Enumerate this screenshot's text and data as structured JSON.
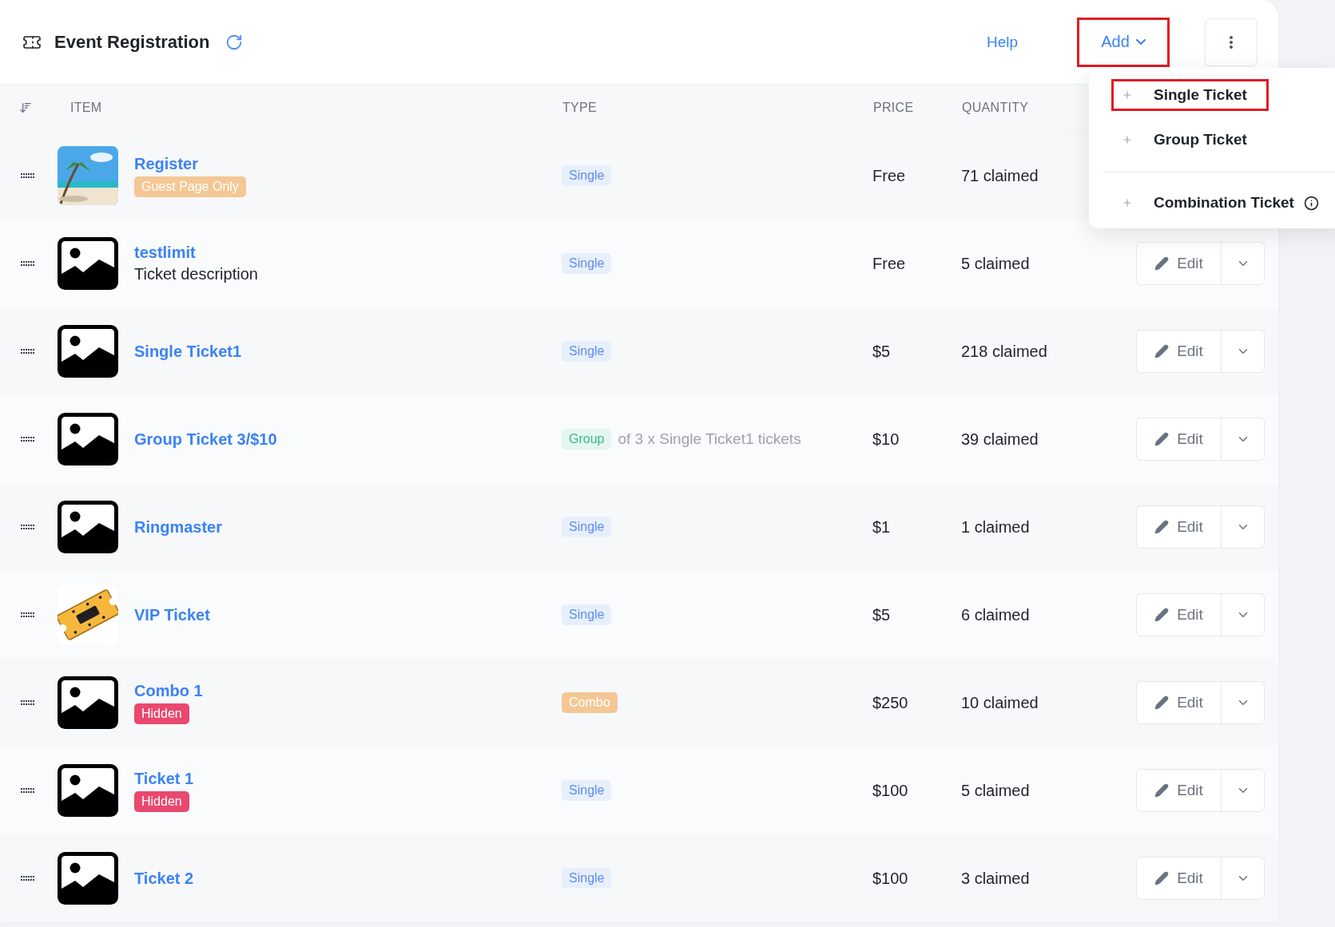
{
  "header": {
    "title": "Event Registration",
    "help": "Help",
    "add_button": {
      "label": "Add",
      "highlighted": true
    }
  },
  "add_menu": {
    "groups": [
      {
        "items": [
          {
            "label": "Single Ticket",
            "highlighted": true,
            "info": false
          },
          {
            "label": "Group Ticket",
            "highlighted": false,
            "info": false
          }
        ]
      },
      {
        "items": [
          {
            "label": "Combination Ticket",
            "highlighted": false,
            "info": true
          }
        ]
      }
    ]
  },
  "table": {
    "columns": [
      "ITEM",
      "TYPE",
      "PRICE",
      "QUANTITY"
    ],
    "rows": [
      {
        "name": "Register",
        "tag": {
          "kind": "guest",
          "label": "Guest Page Only"
        },
        "type": {
          "kind": "single",
          "label": "Single"
        },
        "price": "Free",
        "quantity": "71 claimed"
      },
      {
        "thumbnail": {
          "kind": "placeholder"
        },
        "name": "testlimit",
        "description": "Ticket description",
        "type": {
          "kind": "single",
          "label": "Single"
        },
        "price": "Free",
        "quantity": "5 claimed",
        "edit": "Edit"
      },
      {
        "thumbnail": {
          "kind": "placeholder"
        },
        "name": "Single Ticket1",
        "type": {
          "kind": "single",
          "label": "Single"
        },
        "price": "$5",
        "quantity": "218 claimed",
        "edit": "Edit"
      },
      {
        "thumbnail": {
          "kind": "placeholder"
        },
        "name": "Group Ticket 3/$10",
        "type": {
          "kind": "group",
          "label": "Group",
          "note": "of 3 x Single Ticket1 tickets"
        },
        "price": "$10",
        "quantity": "39 claimed",
        "edit": "Edit"
      },
      {
        "thumbnail": {
          "kind": "placeholder"
        },
        "name": "Ringmaster",
        "type": {
          "kind": "single",
          "label": "Single"
        },
        "price": "$1",
        "quantity": "1 claimed",
        "edit": "Edit"
      },
      {
        "name": "VIP Ticket",
        "type": {
          "kind": "single",
          "label": "Single"
        },
        "price": "$5",
        "quantity": "6 claimed",
        "edit": "Edit"
      },
      {
        "thumbnail": {
          "kind": "placeholder"
        },
        "name": "Combo 1",
        "tag": {
          "kind": "hidden",
          "label": "Hidden"
        },
        "type": {
          "kind": "combo",
          "label": "Combo"
        },
        "price": "$250",
        "quantity": "10 claimed",
        "edit": "Edit"
      },
      {
        "thumbnail": {
          "kind": "placeholder"
        },
        "name": "Ticket 1",
        "tag": {
          "kind": "hidden",
          "label": "Hidden"
        },
        "type": {
          "kind": "single",
          "label": "Single"
        },
        "price": "$100",
        "quantity": "5 claimed",
        "edit": "Edit"
      },
      {
        "thumbnail": {
          "kind": "placeholder"
        },
        "name": "Ticket 2",
        "type": {
          "kind": "single",
          "label": "Single"
        },
        "price": "$100",
        "quantity": "3 claimed",
        "edit": "Edit"
      }
    ]
  }
}
